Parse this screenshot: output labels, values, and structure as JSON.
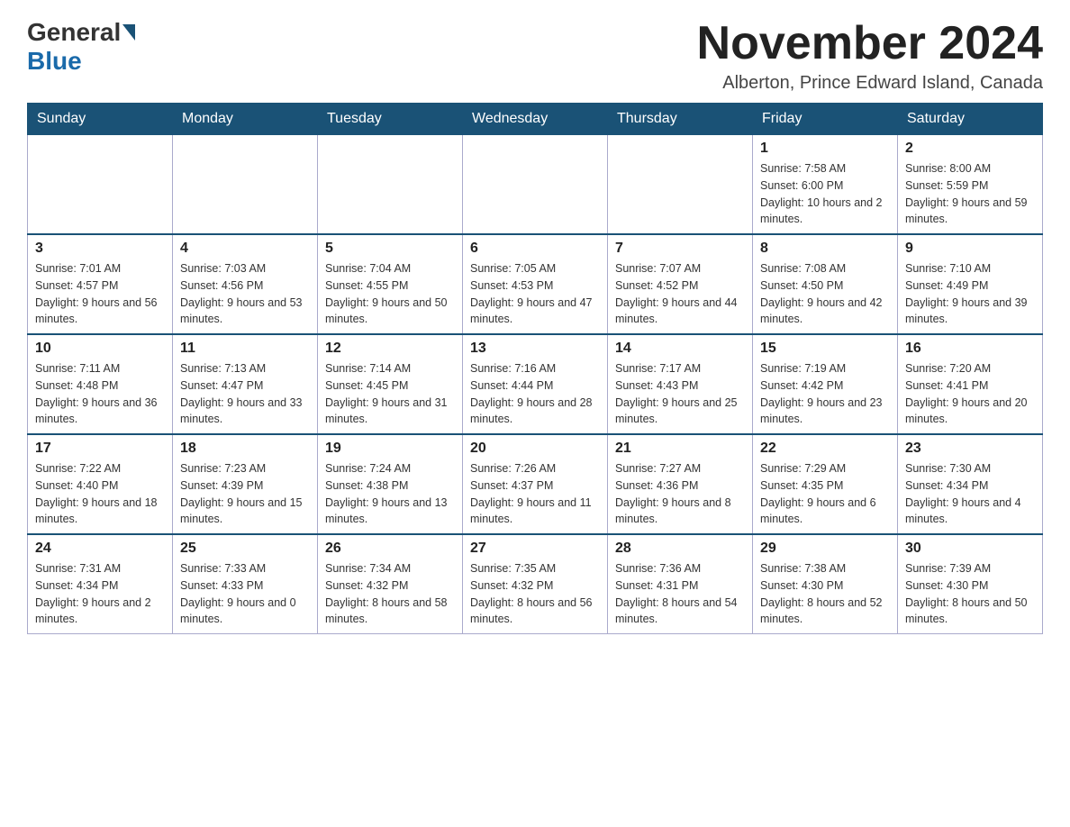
{
  "logo": {
    "general": "General",
    "blue": "Blue"
  },
  "title": "November 2024",
  "location": "Alberton, Prince Edward Island, Canada",
  "weekdays": [
    "Sunday",
    "Monday",
    "Tuesday",
    "Wednesday",
    "Thursday",
    "Friday",
    "Saturday"
  ],
  "weeks": [
    [
      {
        "day": "",
        "info": ""
      },
      {
        "day": "",
        "info": ""
      },
      {
        "day": "",
        "info": ""
      },
      {
        "day": "",
        "info": ""
      },
      {
        "day": "",
        "info": ""
      },
      {
        "day": "1",
        "info": "Sunrise: 7:58 AM\nSunset: 6:00 PM\nDaylight: 10 hours and 2 minutes."
      },
      {
        "day": "2",
        "info": "Sunrise: 8:00 AM\nSunset: 5:59 PM\nDaylight: 9 hours and 59 minutes."
      }
    ],
    [
      {
        "day": "3",
        "info": "Sunrise: 7:01 AM\nSunset: 4:57 PM\nDaylight: 9 hours and 56 minutes."
      },
      {
        "day": "4",
        "info": "Sunrise: 7:03 AM\nSunset: 4:56 PM\nDaylight: 9 hours and 53 minutes."
      },
      {
        "day": "5",
        "info": "Sunrise: 7:04 AM\nSunset: 4:55 PM\nDaylight: 9 hours and 50 minutes."
      },
      {
        "day": "6",
        "info": "Sunrise: 7:05 AM\nSunset: 4:53 PM\nDaylight: 9 hours and 47 minutes."
      },
      {
        "day": "7",
        "info": "Sunrise: 7:07 AM\nSunset: 4:52 PM\nDaylight: 9 hours and 44 minutes."
      },
      {
        "day": "8",
        "info": "Sunrise: 7:08 AM\nSunset: 4:50 PM\nDaylight: 9 hours and 42 minutes."
      },
      {
        "day": "9",
        "info": "Sunrise: 7:10 AM\nSunset: 4:49 PM\nDaylight: 9 hours and 39 minutes."
      }
    ],
    [
      {
        "day": "10",
        "info": "Sunrise: 7:11 AM\nSunset: 4:48 PM\nDaylight: 9 hours and 36 minutes."
      },
      {
        "day": "11",
        "info": "Sunrise: 7:13 AM\nSunset: 4:47 PM\nDaylight: 9 hours and 33 minutes."
      },
      {
        "day": "12",
        "info": "Sunrise: 7:14 AM\nSunset: 4:45 PM\nDaylight: 9 hours and 31 minutes."
      },
      {
        "day": "13",
        "info": "Sunrise: 7:16 AM\nSunset: 4:44 PM\nDaylight: 9 hours and 28 minutes."
      },
      {
        "day": "14",
        "info": "Sunrise: 7:17 AM\nSunset: 4:43 PM\nDaylight: 9 hours and 25 minutes."
      },
      {
        "day": "15",
        "info": "Sunrise: 7:19 AM\nSunset: 4:42 PM\nDaylight: 9 hours and 23 minutes."
      },
      {
        "day": "16",
        "info": "Sunrise: 7:20 AM\nSunset: 4:41 PM\nDaylight: 9 hours and 20 minutes."
      }
    ],
    [
      {
        "day": "17",
        "info": "Sunrise: 7:22 AM\nSunset: 4:40 PM\nDaylight: 9 hours and 18 minutes."
      },
      {
        "day": "18",
        "info": "Sunrise: 7:23 AM\nSunset: 4:39 PM\nDaylight: 9 hours and 15 minutes."
      },
      {
        "day": "19",
        "info": "Sunrise: 7:24 AM\nSunset: 4:38 PM\nDaylight: 9 hours and 13 minutes."
      },
      {
        "day": "20",
        "info": "Sunrise: 7:26 AM\nSunset: 4:37 PM\nDaylight: 9 hours and 11 minutes."
      },
      {
        "day": "21",
        "info": "Sunrise: 7:27 AM\nSunset: 4:36 PM\nDaylight: 9 hours and 8 minutes."
      },
      {
        "day": "22",
        "info": "Sunrise: 7:29 AM\nSunset: 4:35 PM\nDaylight: 9 hours and 6 minutes."
      },
      {
        "day": "23",
        "info": "Sunrise: 7:30 AM\nSunset: 4:34 PM\nDaylight: 9 hours and 4 minutes."
      }
    ],
    [
      {
        "day": "24",
        "info": "Sunrise: 7:31 AM\nSunset: 4:34 PM\nDaylight: 9 hours and 2 minutes."
      },
      {
        "day": "25",
        "info": "Sunrise: 7:33 AM\nSunset: 4:33 PM\nDaylight: 9 hours and 0 minutes."
      },
      {
        "day": "26",
        "info": "Sunrise: 7:34 AM\nSunset: 4:32 PM\nDaylight: 8 hours and 58 minutes."
      },
      {
        "day": "27",
        "info": "Sunrise: 7:35 AM\nSunset: 4:32 PM\nDaylight: 8 hours and 56 minutes."
      },
      {
        "day": "28",
        "info": "Sunrise: 7:36 AM\nSunset: 4:31 PM\nDaylight: 8 hours and 54 minutes."
      },
      {
        "day": "29",
        "info": "Sunrise: 7:38 AM\nSunset: 4:30 PM\nDaylight: 8 hours and 52 minutes."
      },
      {
        "day": "30",
        "info": "Sunrise: 7:39 AM\nSunset: 4:30 PM\nDaylight: 8 hours and 50 minutes."
      }
    ]
  ]
}
